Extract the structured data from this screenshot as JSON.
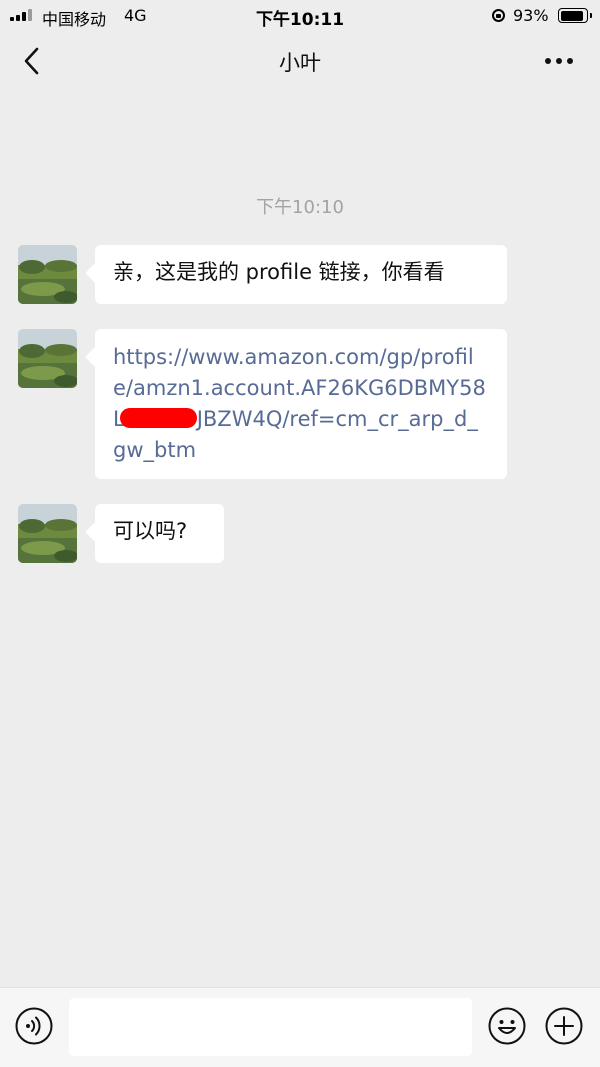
{
  "status_bar": {
    "carrier": "中国移动",
    "network": "4G",
    "time": "下午10:11",
    "battery_percent": "93%",
    "battery_level": 0.93,
    "icons": [
      "signal-icon",
      "orientation-lock-icon",
      "battery-icon"
    ]
  },
  "nav": {
    "title": "小叶",
    "back_icon": "chevron-left-icon",
    "more_icon": "more-dots-icon"
  },
  "chat": {
    "timestamp": "下午10:10",
    "messages": [
      {
        "text": "亲，这是我的 profile 链接，你看看"
      },
      {
        "link_part1": "https://www.amazon.com/gp/profile/amzn1.account.AF26KG6DBMY58L",
        "link_part2": "JBZW4Q/ref=cm_cr_arp_d_gw_btm",
        "redaction_color": "#ff0000"
      },
      {
        "text": "可以吗?"
      }
    ]
  },
  "input_bar": {
    "voice_icon": "voice-icon",
    "emoji_icon": "emoji-icon",
    "plus_icon": "plus-icon",
    "value": ""
  },
  "colors": {
    "background": "#ededed",
    "bubble": "#ffffff",
    "link": "#576b95",
    "timestamp": "#a3a3a3"
  }
}
